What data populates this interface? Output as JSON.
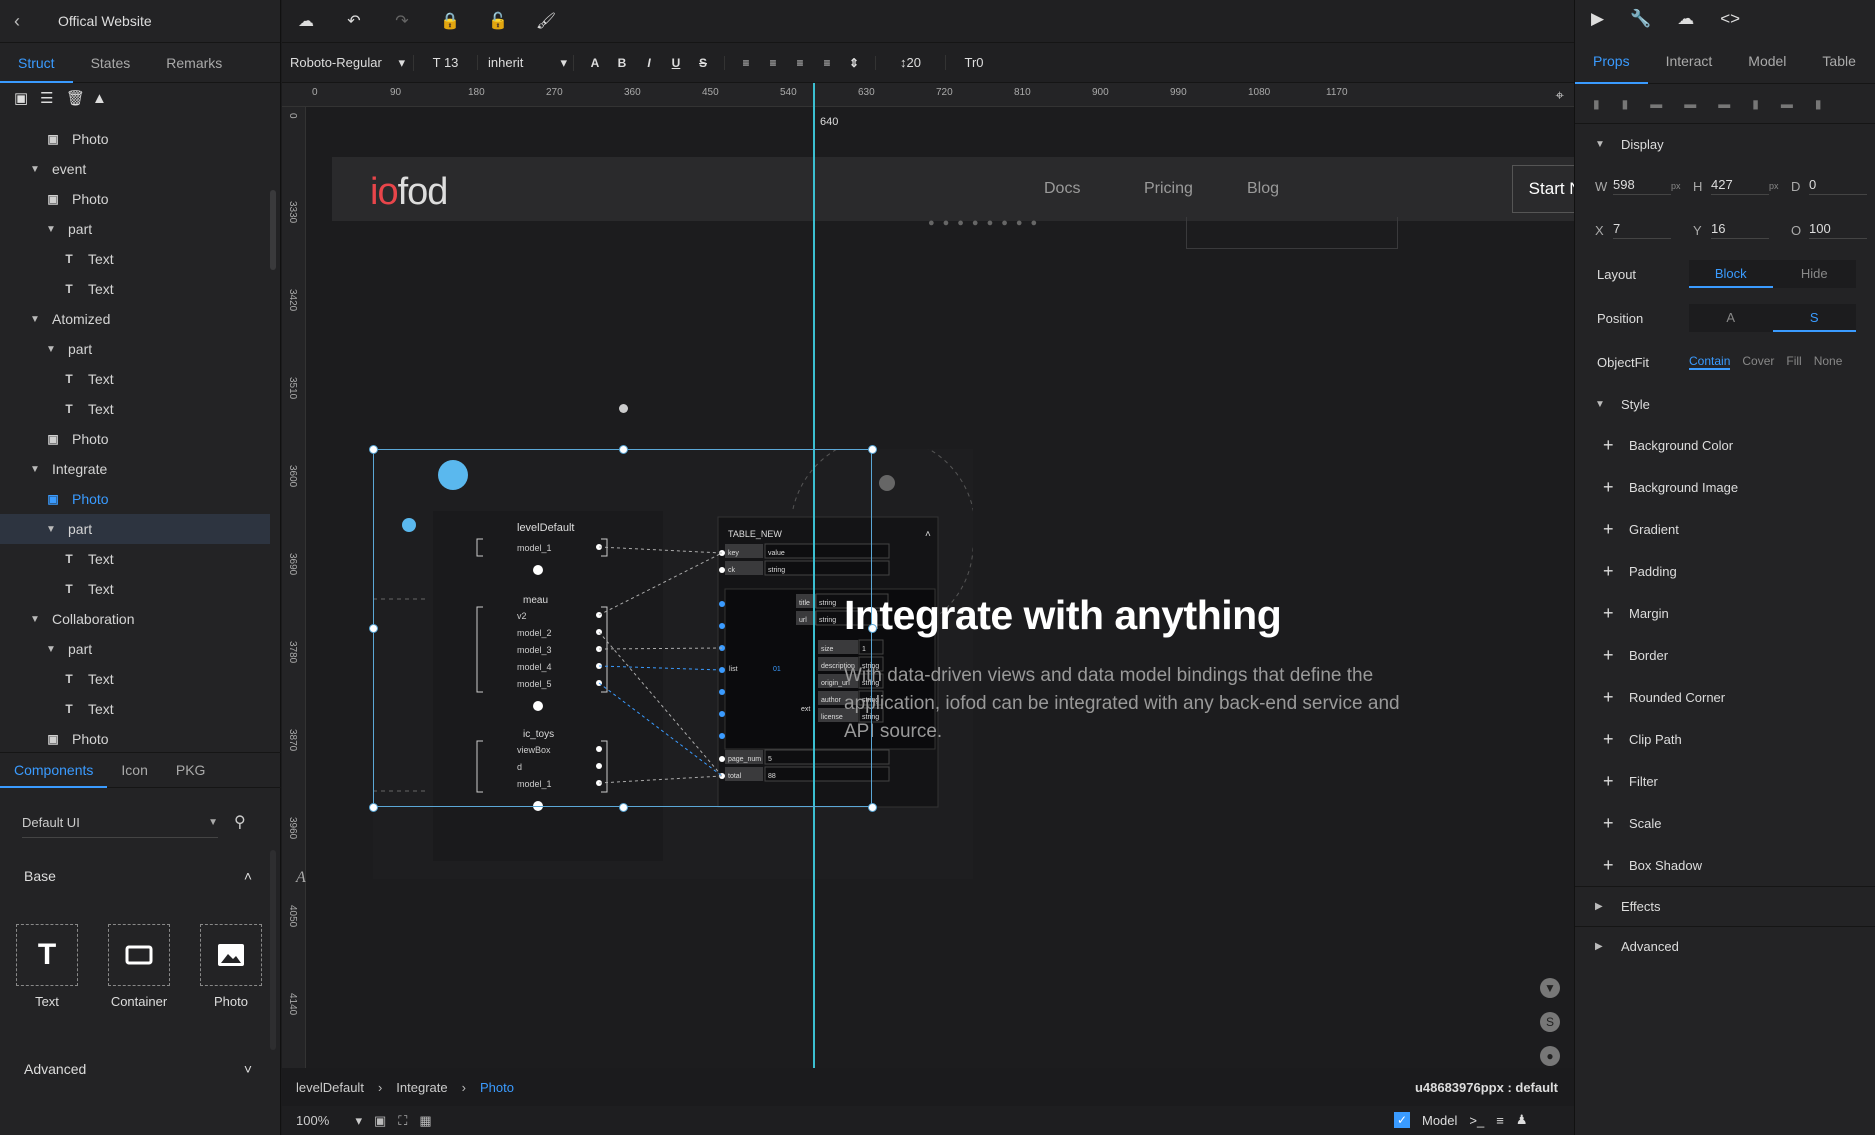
{
  "project": {
    "back_icon": "chevron-left-icon",
    "title": "Offical Website"
  },
  "left_tabs": [
    "Struct",
    "States",
    "Remarks"
  ],
  "tree_tools": [
    "add-page-icon",
    "layers-icon",
    "trash-icon",
    "assets-icon"
  ],
  "tree": [
    {
      "label": "Photo",
      "type": "photo",
      "indent": 2
    },
    {
      "label": "event",
      "type": "group",
      "indent": 1
    },
    {
      "label": "Photo",
      "type": "photo",
      "indent": 2
    },
    {
      "label": "part",
      "type": "group",
      "indent": 2
    },
    {
      "label": "Text",
      "type": "text",
      "indent": 3
    },
    {
      "label": "Text",
      "type": "text",
      "indent": 3
    },
    {
      "label": "Atomized",
      "type": "group",
      "indent": 1
    },
    {
      "label": "part",
      "type": "group",
      "indent": 2
    },
    {
      "label": "Text",
      "type": "text",
      "indent": 3
    },
    {
      "label": "Text",
      "type": "text",
      "indent": 3
    },
    {
      "label": "Photo",
      "type": "photo",
      "indent": 2
    },
    {
      "label": "Integrate",
      "type": "group",
      "indent": 1
    },
    {
      "label": "Photo",
      "type": "photo",
      "indent": 2,
      "selected_blue": true
    },
    {
      "label": "part",
      "type": "group",
      "indent": 2,
      "highlight": true
    },
    {
      "label": "Text",
      "type": "text",
      "indent": 3
    },
    {
      "label": "Text",
      "type": "text",
      "indent": 3
    },
    {
      "label": "Collaboration",
      "type": "group",
      "indent": 1
    },
    {
      "label": "part",
      "type": "group",
      "indent": 2
    },
    {
      "label": "Text",
      "type": "text",
      "indent": 3
    },
    {
      "label": "Text",
      "type": "text",
      "indent": 3
    },
    {
      "label": "Photo",
      "type": "photo",
      "indent": 2
    }
  ],
  "component_tabs": [
    "Components",
    "Icon",
    "PKG"
  ],
  "library": {
    "value": "Default UI"
  },
  "base": {
    "title": "Base",
    "items": [
      "Text",
      "Container",
      "Photo"
    ]
  },
  "advanced_left": "Advanced",
  "fmt": {
    "font": "Roboto-Regular",
    "size": "13",
    "family": "inherit",
    "line_height": "20",
    "letter_spacing": "0"
  },
  "ruler_top": [
    "0",
    "90",
    "180",
    "270",
    "360",
    "450",
    "540",
    "630",
    "720",
    "810",
    "900",
    "990",
    "1080",
    "1170"
  ],
  "ruler_left": [
    "0",
    "3330",
    "3420",
    "3510",
    "3600",
    "3690",
    "3780",
    "3870",
    "3960",
    "4050",
    "4140"
  ],
  "guide_label": "640",
  "site": {
    "logo": {
      "a": "io",
      "b": "fod"
    },
    "nav": [
      "Docs",
      "Pricing",
      "Blog"
    ],
    "cta": "Start Now",
    "headline": "Integrate with anything",
    "para": "With data-driven views and data model bindings that define the application, iofod can be integrated with any back-end service and API source."
  },
  "diagram": {
    "left_title": "levelDefault",
    "group1": [
      "model_1"
    ],
    "group2_title": "meau",
    "group2": [
      "v2",
      "model_2",
      "model_3",
      "model_4",
      "model_5"
    ],
    "group3_title": "ic_toys",
    "group3": [
      "viewBox",
      "d",
      "model_1"
    ],
    "table_title": "TABLE_NEW",
    "rows": [
      [
        "key",
        "value"
      ],
      [
        "ck",
        "string"
      ]
    ],
    "list_label": "list",
    "list_mark": "01",
    "list_fields": [
      [
        "title",
        "string"
      ],
      [
        "url",
        "string"
      ]
    ],
    "ext_label": "ext",
    "ext_fields": [
      [
        "size",
        "1"
      ],
      [
        "description",
        "string"
      ],
      [
        "origin_url",
        "string"
      ],
      [
        "author",
        "string"
      ],
      [
        "license",
        "string"
      ]
    ],
    "bottom_rows": [
      [
        "page_num",
        "5"
      ],
      [
        "total",
        "88"
      ]
    ]
  },
  "right_top_icons": [
    "play-icon",
    "wrench-icon",
    "cloud-icon",
    "code-icon"
  ],
  "right_tabs": [
    "Props",
    "Interact",
    "Model",
    "Table"
  ],
  "display": {
    "title": "Display",
    "w": "598",
    "h": "427",
    "d": "0",
    "x": "7",
    "y": "16",
    "o": "100",
    "unit": "px"
  },
  "layout": {
    "label": "Layout",
    "options": [
      "Block",
      "Hide"
    ]
  },
  "position": {
    "label": "Position",
    "options": [
      "A",
      "S"
    ]
  },
  "objectfit": {
    "label": "ObjectFit",
    "options": [
      "Contain",
      "Cover",
      "Fill",
      "None"
    ]
  },
  "style": {
    "title": "Style",
    "items": [
      "Background Color",
      "Background Image",
      "Gradient",
      "Padding",
      "Margin",
      "Border",
      "Rounded Corner",
      "Clip Path",
      "Filter",
      "Scale",
      "Box Shadow"
    ]
  },
  "effects": "Effects",
  "advanced_right": "Advanced",
  "breadcrumb": [
    "levelDefault",
    "Integrate",
    "Photo"
  ],
  "px_id": "u48683976ppx : default",
  "zoom": "100%",
  "model_toggle": "Model",
  "accent": "#3a9bff"
}
